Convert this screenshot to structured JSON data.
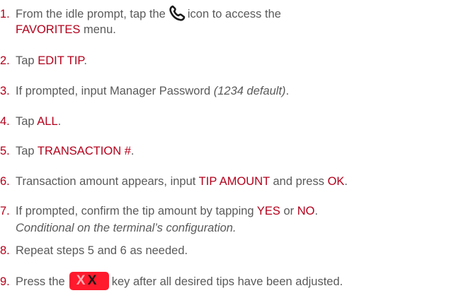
{
  "steps": [
    {
      "num": "1.",
      "a": "From the idle prompt, tap the",
      "b": "icon to access the",
      "c": "FAVORITES",
      "d": " menu."
    },
    {
      "num": "2.",
      "a": "Tap ",
      "b": "EDIT TIP",
      "c": "."
    },
    {
      "num": "3.",
      "a": "If prompted, input Manager Password ",
      "b": "(1234 default)",
      "c": "."
    },
    {
      "num": "4.",
      "a": "Tap ",
      "b": "ALL",
      "c": "."
    },
    {
      "num": "5.",
      "a": "Tap ",
      "b": "TRANSACTION #",
      "c": "."
    },
    {
      "num": "6.",
      "a": "Transaction amount appears, input ",
      "b": "TIP AMOUNT",
      "c": " and press ",
      "d": "OK",
      "e": "."
    },
    {
      "num": "7.",
      "a": "If prompted, confirm the tip amount by tapping ",
      "b": "YES",
      "c": " or ",
      "d": "NO",
      "e": ".",
      "f": "Conditional on the terminal’s configuration."
    },
    {
      "num": "8.",
      "a": "Repeat steps 5 and 6 as needed."
    },
    {
      "num": "9.",
      "a": "Press the",
      "key_x1": "X",
      "key_x2": "X",
      "b": "key after all desired tips have been adjusted."
    }
  ],
  "colors": {
    "accent": "#b3001b",
    "text": "#5a5a5a",
    "key": "#ff1a2d"
  },
  "icons": {
    "step1": "phone-handset-icon",
    "step9": "cancel-x-key-icon"
  }
}
